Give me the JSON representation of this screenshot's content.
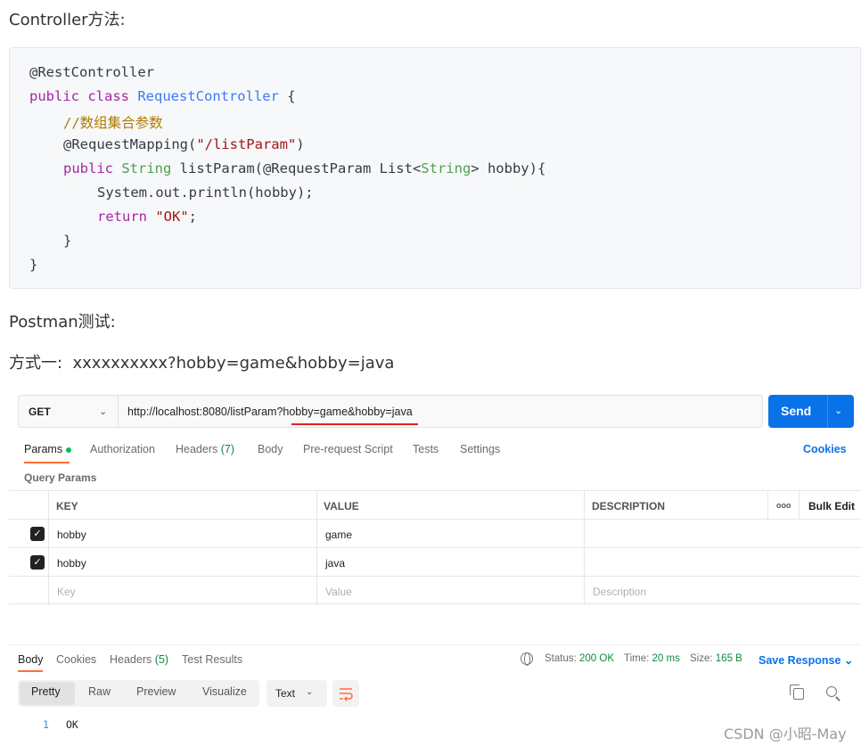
{
  "article": {
    "heading_controller": "Controller方法:",
    "heading_postman": "Postman测试:",
    "heading_method1": "方式一:  xxxxxxxxxx?hobby=game&hobby=java"
  },
  "code": {
    "l1": "@RestController",
    "l2_kw": "public class ",
    "l2_cls": "RequestController",
    "l2_rest": " {",
    "l3": "//数组集合参数",
    "l4_a": "@RequestMapping(",
    "l4_str": "\"/listParam\"",
    "l4_b": ")",
    "l5_kw": "public ",
    "l5_typ": "String",
    "l5_mid": " listParam(@RequestParam List<",
    "l5_typ2": "String",
    "l5_end": "> hobby){",
    "l6": "System.out.println(hobby);",
    "l7_kw": "return ",
    "l7_str": "\"OK\"",
    "l7_end": ";",
    "l8": "}",
    "l9": "}"
  },
  "postman": {
    "method": "GET",
    "url": "http://localhost:8080/listParam?hobby=game&hobby=java",
    "send_label": "Send",
    "tabs": {
      "params": "Params",
      "authorization": "Authorization",
      "headers": "Headers",
      "headers_count": "(7)",
      "body": "Body",
      "prerequest": "Pre-request Script",
      "tests": "Tests",
      "settings": "Settings"
    },
    "cookies_link": "Cookies",
    "query_params_label": "Query Params",
    "table": {
      "headers": {
        "key": "KEY",
        "value": "VALUE",
        "description": "DESCRIPTION",
        "more": "ooo",
        "bulk": "Bulk Edit"
      },
      "rows": [
        {
          "key": "hobby",
          "value": "game"
        },
        {
          "key": "hobby",
          "value": "java"
        }
      ],
      "placeholder": {
        "key": "Key",
        "value": "Value",
        "description": "Description"
      }
    },
    "response": {
      "tabs": {
        "body": "Body",
        "cookies": "Cookies",
        "headers": "Headers",
        "headers_count": "(5)",
        "test_results": "Test Results"
      },
      "status_label": "Status:",
      "status_value": "200 OK",
      "time_label": "Time:",
      "time_value": "20 ms",
      "size_label": "Size:",
      "size_value": "165 B",
      "save_response": "Save Response",
      "view_modes": [
        "Pretty",
        "Raw",
        "Preview",
        "Visualize"
      ],
      "format": "Text",
      "line_number": "1",
      "body_text": "OK"
    }
  },
  "watermark": "CSDN @小昭-May"
}
